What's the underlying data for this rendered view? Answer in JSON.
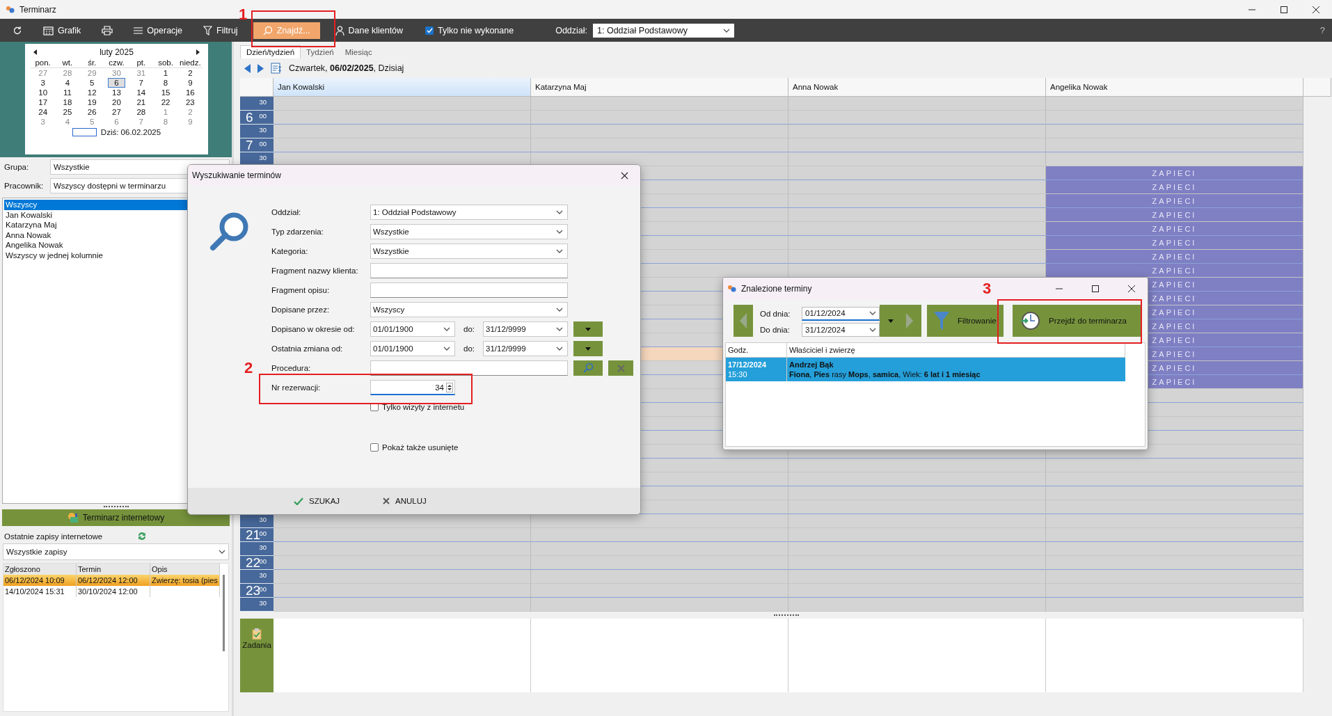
{
  "window": {
    "title": "Terminarz"
  },
  "toolbar": {
    "buttons": [
      {
        "kind": "refresh",
        "selected": false
      },
      {
        "kind": "calendar",
        "label": "Grafik",
        "selected": false
      },
      {
        "kind": "print",
        "selected": false
      },
      {
        "kind": "menu",
        "label": "Operacje",
        "selected": false
      },
      {
        "kind": "filter",
        "label": "Filtruj",
        "selected": false
      },
      {
        "kind": "search",
        "label": "Znajdź...",
        "selected": true
      },
      {
        "kind": "person",
        "label": "Dane klientów",
        "selected": false
      }
    ],
    "only_pending": {
      "label": "Tylko nie wykonane",
      "checked": true
    },
    "branch": {
      "label": "Oddział:",
      "value": "1: Oddział Podstawowy"
    },
    "help": "?"
  },
  "calendar": {
    "month": "luty 2025",
    "weekdays": [
      "pon.",
      "wt.",
      "śr.",
      "czw.",
      "pt.",
      "sob.",
      "niedz."
    ],
    "weeks": [
      [
        {
          "day": "27",
          "in_month": false,
          "selected": false
        },
        {
          "day": "28",
          "in_month": false,
          "selected": false
        },
        {
          "day": "29",
          "in_month": false,
          "selected": false
        },
        {
          "day": "30",
          "in_month": false,
          "selected": false
        },
        {
          "day": "31",
          "in_month": false,
          "selected": false
        },
        {
          "day": "1",
          "in_month": true,
          "selected": false
        },
        {
          "day": "2",
          "in_month": true,
          "selected": false
        }
      ],
      [
        {
          "day": "3",
          "in_month": true,
          "selected": false
        },
        {
          "day": "4",
          "in_month": true,
          "selected": false
        },
        {
          "day": "5",
          "in_month": true,
          "selected": false
        },
        {
          "day": "6",
          "in_month": true,
          "selected": true
        },
        {
          "day": "7",
          "in_month": true,
          "selected": false
        },
        {
          "day": "8",
          "in_month": true,
          "selected": false
        },
        {
          "day": "9",
          "in_month": true,
          "selected": false
        }
      ],
      [
        {
          "day": "10",
          "in_month": true,
          "selected": false
        },
        {
          "day": "11",
          "in_month": true,
          "selected": false
        },
        {
          "day": "12",
          "in_month": true,
          "selected": false
        },
        {
          "day": "13",
          "in_month": true,
          "selected": false
        },
        {
          "day": "14",
          "in_month": true,
          "selected": false
        },
        {
          "day": "15",
          "in_month": true,
          "selected": false
        },
        {
          "day": "16",
          "in_month": true,
          "selected": false
        }
      ],
      [
        {
          "day": "17",
          "in_month": true,
          "selected": false
        },
        {
          "day": "18",
          "in_month": true,
          "selected": false
        },
        {
          "day": "19",
          "in_month": true,
          "selected": false
        },
        {
          "day": "20",
          "in_month": true,
          "selected": false
        },
        {
          "day": "21",
          "in_month": true,
          "selected": false
        },
        {
          "day": "22",
          "in_month": true,
          "selected": false
        },
        {
          "day": "23",
          "in_month": true,
          "selected": false
        }
      ],
      [
        {
          "day": "24",
          "in_month": true,
          "selected": false
        },
        {
          "day": "25",
          "in_month": true,
          "selected": false
        },
        {
          "day": "26",
          "in_month": true,
          "selected": false
        },
        {
          "day": "27",
          "in_month": true,
          "selected": false
        },
        {
          "day": "28",
          "in_month": true,
          "selected": false
        },
        {
          "day": "1",
          "in_month": false,
          "selected": false
        },
        {
          "day": "2",
          "in_month": false,
          "selected": false
        }
      ],
      [
        {
          "day": "3",
          "in_month": false,
          "selected": false
        },
        {
          "day": "4",
          "in_month": false,
          "selected": false
        },
        {
          "day": "5",
          "in_month": false,
          "selected": false
        },
        {
          "day": "6",
          "in_month": false,
          "selected": false
        },
        {
          "day": "7",
          "in_month": false,
          "selected": false
        },
        {
          "day": "8",
          "in_month": false,
          "selected": false
        },
        {
          "day": "9",
          "in_month": false,
          "selected": false
        }
      ]
    ],
    "today": "Dziś: 06.02.2025"
  },
  "group": {
    "label": "Grupa:",
    "value": "Wszystkie"
  },
  "employee": {
    "label": "Pracownik:",
    "value": "Wszyscy dostępni w terminarzu"
  },
  "employee_list": [
    {
      "label": "Wszyscy",
      "selected": true
    },
    {
      "label": "Jan Kowalski",
      "selected": false
    },
    {
      "label": "Katarzyna Maj",
      "selected": false
    },
    {
      "label": "Anna Nowak",
      "selected": false
    },
    {
      "label": "Angelika Nowak",
      "selected": false
    },
    {
      "label": "Wszyscy w jednej kolumnie",
      "selected": false
    }
  ],
  "online": {
    "title": "Terminarz internetowy",
    "subtitle": "Ostatnie zapisy internetowe",
    "filter": "Wszystkie zapisy",
    "columns": [
      "Zgłoszono",
      "Termin",
      "Opis"
    ],
    "rows": [
      {
        "cells": [
          "06/12/2024 10:09",
          "06/12/2024 12:00",
          "Zwierzę: tosia (pies"
        ],
        "selected": true
      },
      {
        "cells": [
          "14/10/2024 15:31",
          "30/10/2024 12:00"
        ],
        "selected": false
      }
    ]
  },
  "schedule": {
    "tabs": [
      {
        "label": "Dzień/tydzień",
        "selected": true
      },
      {
        "label": "Tydzień",
        "selected": false
      },
      {
        "label": "Miesiąc",
        "selected": false
      }
    ],
    "date_line": "Czwartek, **06/02/2025**, Dzisiaj",
    "columns": [
      {
        "name": "Jan Kowalski",
        "selected": true
      },
      {
        "name": "Katarzyna Maj",
        "selected": false
      },
      {
        "name": "Anna Nowak",
        "selected": false
      },
      {
        "name": "Angelika Nowak",
        "selected": false
      }
    ],
    "time_rows": [
      {
        "minute": "30",
        "selected": false
      },
      {
        "hour": "6",
        "minute": "00",
        "selected": false
      },
      {
        "minute": "30",
        "selected": false
      },
      {
        "hour": "7",
        "minute": "00",
        "selected": false
      },
      {
        "minute": "30",
        "selected": false
      },
      {
        "selected": false,
        "blocked_label": "ZAPIECI"
      },
      {
        "selected": false,
        "blocked_label": "ZAPIECI"
      },
      {
        "selected": false,
        "blocked_label": "ZAPIECI"
      },
      {
        "selected": false,
        "blocked_label": "ZAPIECI"
      },
      {
        "selected": false,
        "blocked_label": "ZAPIECI"
      },
      {
        "selected": false,
        "blocked_label": "ZAPIECI"
      },
      {
        "selected": false,
        "blocked_label": "ZAPIECI"
      },
      {
        "selected": false,
        "blocked_label": "ZAPIECI"
      },
      {
        "selected": false,
        "blocked_label": "ZAPIECI"
      },
      {
        "selected": false,
        "blocked_label": "ZAPIECI"
      },
      {
        "selected": false,
        "blocked_label": "ZAPIECI"
      },
      {
        "selected": false,
        "blocked_label": "ZAPIECI"
      },
      {
        "selected": false,
        "blocked_label": "ZAPIECI"
      },
      {
        "selected": true,
        "blocked_label": "ZAPIECI"
      },
      {
        "selected": false,
        "blocked_label": "ZAPIECI"
      },
      {
        "selected": false,
        "blocked_label": "ZAPIECI"
      },
      {
        "selected": false
      },
      {
        "selected": false
      },
      {
        "selected": false
      },
      {
        "selected": false
      },
      {
        "selected": false
      },
      {
        "selected": false
      },
      {
        "selected": false
      },
      {
        "selected": false
      },
      {
        "selected": false
      },
      {
        "minute": "30",
        "selected": false
      },
      {
        "hour": "21",
        "minute": "00",
        "selected": false
      },
      {
        "minute": "30",
        "selected": false
      },
      {
        "hour": "22",
        "minute": "00",
        "selected": false
      },
      {
        "minute": "30",
        "selected": false
      },
      {
        "hour": "23",
        "minute": "00",
        "selected": false
      },
      {
        "minute": "30",
        "selected": false
      }
    ],
    "tasks": "Zadania"
  },
  "search_dialog": {
    "title": "Wyszukiwanie terminów",
    "fields": [
      {
        "kind": "select",
        "label": "Oddział:",
        "value": "1: Oddział Podstawowy"
      },
      {
        "kind": "select",
        "label": "Typ zdarzenia:",
        "value": "Wszystkie"
      },
      {
        "kind": "select",
        "label": "Kategoria:",
        "value": "Wszystkie"
      },
      {
        "kind": "text",
        "label": "Fragment nazwy klienta:"
      },
      {
        "kind": "text",
        "label": "Fragment opisu:"
      },
      {
        "kind": "select",
        "label": "Dopisane przez:",
        "value": "Wszyscy"
      },
      {
        "kind": "range",
        "label": "Dopisano w okresie od:",
        "from": "01/01/1900",
        "to_label": "do:",
        "to": "31/12/9999"
      },
      {
        "kind": "range",
        "label": "Ostatnia zmiana od:",
        "from": "01/01/1900",
        "to_label": "do:",
        "to": "31/12/9999"
      },
      {
        "kind": "lookup",
        "label": "Procedura:"
      },
      {
        "kind": "number",
        "label": "Nr rezerwacji:",
        "value": "34"
      },
      {
        "kind": "checkbox",
        "label": "Tylko wizyty z internetu",
        "checked": false
      },
      {
        "kind": "checkbox",
        "label": "Pokaż także usunięte",
        "checked": false
      }
    ],
    "buttons": [
      {
        "kind": "ok",
        "label": "SZUKAJ"
      },
      {
        "kind": "cancel",
        "label": "ANULUJ"
      }
    ]
  },
  "found_dialog": {
    "title": "Znalezione terminy",
    "from_label": "Od dnia:",
    "from": "01/12/2024",
    "to_label": "Do dnia:",
    "to": "31/12/2024",
    "filter_button": "Filtrowanie",
    "go_button": "Przejdź do terminarza",
    "columns": [
      "Godz.",
      "Właściciel i zwierzę"
    ],
    "rows": [
      {
        "date": "17/12/2024",
        "time": "15:30",
        "owner": "Andrzej Bąk",
        "details": "**Fiona**, **Pies** rasy **Mops**, **samica**, Wiek: **6 lat i 1 miesiąc**",
        "selected": true
      }
    ]
  },
  "annotations": [
    {
      "label": "1"
    },
    {
      "label": "2"
    },
    {
      "label": "3"
    }
  ]
}
